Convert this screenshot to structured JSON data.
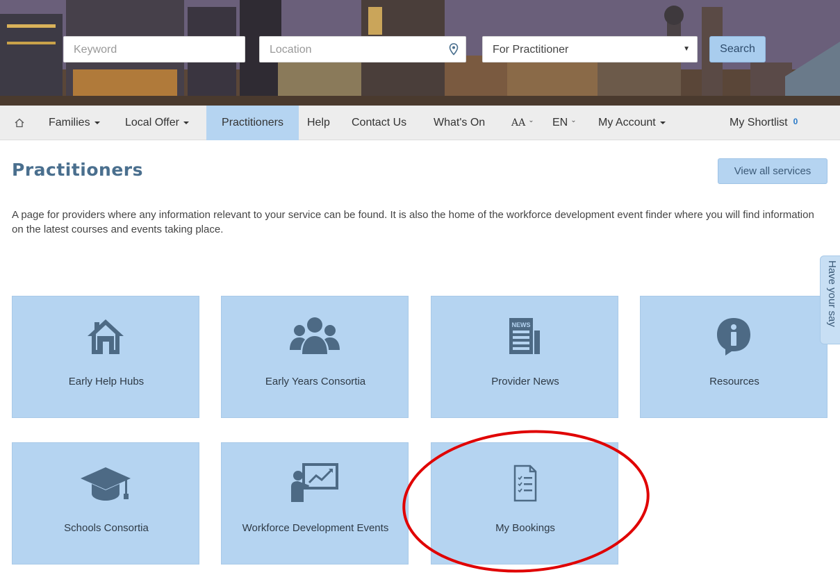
{
  "header": {
    "keyword_placeholder": "Keyword",
    "location_placeholder": "Location",
    "audience_select_value": "For Practitioner",
    "search_label": "Search"
  },
  "nav": {
    "home_icon": "home-icon",
    "items": [
      {
        "label": "Families",
        "dropdown": true
      },
      {
        "label": "Local Offer",
        "dropdown": true
      },
      {
        "label": "Practitioners",
        "active": true
      },
      {
        "label": "Help"
      },
      {
        "label": "Contact Us"
      },
      {
        "label": "What's On"
      },
      {
        "label": "AA"
      },
      {
        "label": "EN"
      },
      {
        "label": "My Account",
        "dropdown": true
      },
      {
        "label": "My Shortlist",
        "count": "0"
      }
    ]
  },
  "page": {
    "title": "Practitioners",
    "view_all_label": "View all services",
    "intro": "A page for providers where any information relevant to your service can be found.  It is also the home of the workforce development event finder where you will find information on the latest courses and events taking place."
  },
  "tiles": [
    {
      "label": "Early Help Hubs",
      "icon": "house-icon"
    },
    {
      "label": "Early Years Consortia",
      "icon": "people-group-icon"
    },
    {
      "label": "Provider News",
      "icon": "newspaper-icon",
      "icon_text": "NEWS"
    },
    {
      "label": "Resources",
      "icon": "info-bubble-icon"
    },
    {
      "label": "Schools Consortia",
      "icon": "graduation-cap-icon"
    },
    {
      "label": "Workforce Development Events",
      "icon": "presentation-icon"
    },
    {
      "label": "My Bookings",
      "icon": "checklist-document-icon"
    }
  ],
  "feedback_tab": {
    "label": "Have your say"
  },
  "colors": {
    "tile_bg": "#b5d4f1",
    "title_color": "#4a6f8e",
    "nav_bg": "#ededed",
    "annotation": "#e00000",
    "icon_color": "#4d6a85"
  }
}
